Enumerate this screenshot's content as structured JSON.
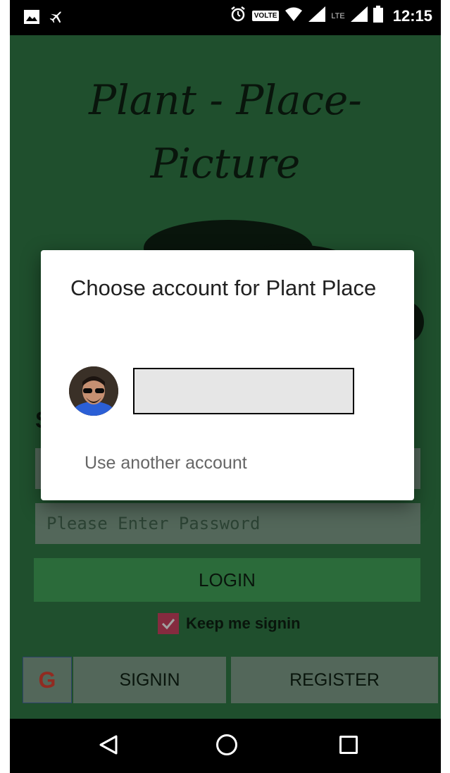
{
  "status_bar": {
    "time": "12:15",
    "volte_label": "VOLTE",
    "lte_label": "LTE"
  },
  "app": {
    "title_line1": "Plant - Place-",
    "title_line2": "Picture",
    "section_initial": "S",
    "password_placeholder": "Please Enter Password",
    "login_label": "LOGIN",
    "keep_signin_label": "Keep me signin",
    "keep_signin_checked": true,
    "google_glyph": "G",
    "signin_label": "SIGNIN",
    "register_label": "REGISTER"
  },
  "dialog": {
    "title": "Choose account for Plant Place",
    "use_another_label": "Use another account"
  },
  "icons": {
    "status_left": [
      "image-icon",
      "airplane-icon"
    ],
    "status_right": [
      "alarm-icon",
      "volte-icon",
      "wifi-icon",
      "signal-icon",
      "lte-signal-icon",
      "battery-icon"
    ],
    "nav": [
      "back-icon",
      "home-icon",
      "recents-icon"
    ]
  },
  "colors": {
    "app_background": "#2a6a3c",
    "login_button": "#3a8f4e",
    "field_background": "#6f8a79",
    "checkbox": "#b23a55",
    "dialog_background": "#ffffff"
  }
}
